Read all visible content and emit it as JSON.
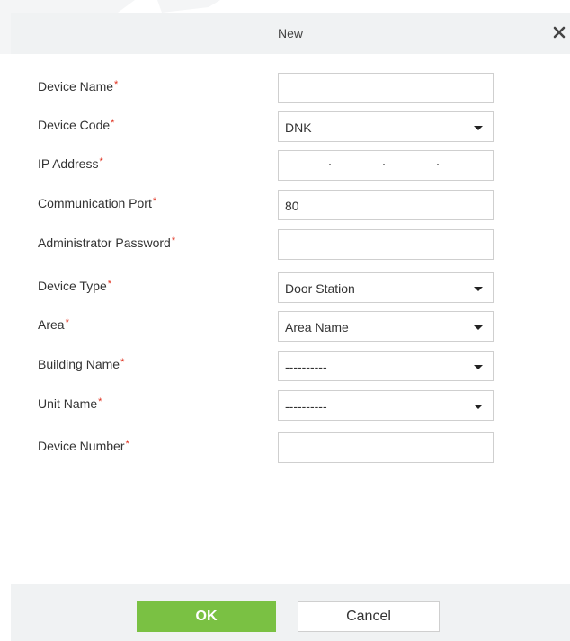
{
  "dialog": {
    "title": "New",
    "close_icon": "close-icon"
  },
  "form": {
    "required_mark": "*",
    "fields": [
      {
        "label": "Device Name",
        "type": "text",
        "value": ""
      },
      {
        "label": "Device Code",
        "type": "select",
        "value": "DNK"
      },
      {
        "label": "IP Address",
        "type": "ip",
        "value": ""
      },
      {
        "label": "Communication Port",
        "type": "text",
        "value": "80"
      },
      {
        "label": "Administrator Password",
        "type": "password",
        "value": ""
      },
      {
        "label": "Device Type",
        "type": "select",
        "value": "Door Station"
      },
      {
        "label": "Area",
        "type": "select",
        "value": "Area Name"
      },
      {
        "label": "Building Name",
        "type": "select",
        "value": "----------"
      },
      {
        "label": "Unit Name",
        "type": "select",
        "value": "----------"
      },
      {
        "label": "Device Number",
        "type": "text",
        "value": ""
      }
    ]
  },
  "footer": {
    "ok_label": "OK",
    "cancel_label": "Cancel"
  },
  "colors": {
    "ok_button": "#7ac143",
    "required_mark": "#e0301e",
    "header_bg": "#f0f2f3"
  }
}
